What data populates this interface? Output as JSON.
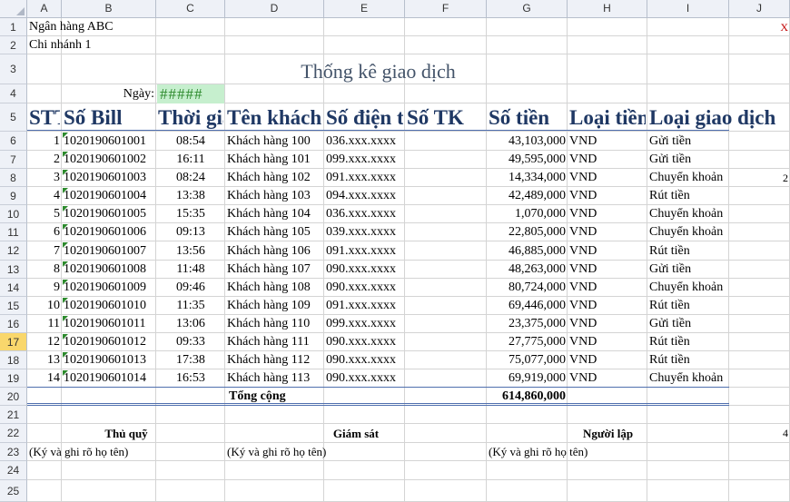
{
  "columns": [
    "A",
    "B",
    "C",
    "D",
    "E",
    "F",
    "G",
    "H",
    "I",
    "J"
  ],
  "rows": [
    "1",
    "2",
    "3",
    "4",
    "5",
    "6",
    "7",
    "8",
    "9",
    "10",
    "11",
    "12",
    "13",
    "14",
    "15",
    "16",
    "17",
    "18",
    "19",
    "20",
    "21",
    "22",
    "23",
    "24",
    "25"
  ],
  "selected_row": "17",
  "bank_name": "Ngân hàng ABC",
  "branch": "Chi nhánh 1",
  "title": "Thống kê giao dịch",
  "date_label": "Ngày:",
  "date_value": "#####",
  "headers": {
    "stt": "STT",
    "bill": "Số Bill",
    "time": "Thời gian",
    "customer": "Tên khách hàng",
    "phone": "Số điện thoại",
    "account": "Số TK",
    "amount": "Số tiền",
    "currency": "Loại tiền",
    "type": "Loại giao dịch"
  },
  "transactions": [
    {
      "stt": "1",
      "bill": "1020190601001",
      "time": "08:54",
      "customer": "Khách hàng 100",
      "phone": "036.xxx.xxxx",
      "amount": "43,103,000",
      "currency": "VND",
      "type": "Gửi tiền"
    },
    {
      "stt": "2",
      "bill": "1020190601002",
      "time": "16:11",
      "customer": "Khách hàng 101",
      "phone": "099.xxx.xxxx",
      "amount": "49,595,000",
      "currency": "VND",
      "type": "Gửi tiền"
    },
    {
      "stt": "3",
      "bill": "1020190601003",
      "time": "08:24",
      "customer": "Khách hàng 102",
      "phone": "091.xxx.xxxx",
      "amount": "14,334,000",
      "currency": "VND",
      "type": "Chuyển khoản"
    },
    {
      "stt": "4",
      "bill": "1020190601004",
      "time": "13:38",
      "customer": "Khách hàng 103",
      "phone": "094.xxx.xxxx",
      "amount": "42,489,000",
      "currency": "VND",
      "type": "Rút tiền"
    },
    {
      "stt": "5",
      "bill": "1020190601005",
      "time": "15:35",
      "customer": "Khách hàng 104",
      "phone": "036.xxx.xxxx",
      "amount": "1,070,000",
      "currency": "VND",
      "type": "Chuyển khoản"
    },
    {
      "stt": "6",
      "bill": "1020190601006",
      "time": "09:13",
      "customer": "Khách hàng 105",
      "phone": "039.xxx.xxxx",
      "amount": "22,805,000",
      "currency": "VND",
      "type": "Chuyển khoản"
    },
    {
      "stt": "7",
      "bill": "1020190601007",
      "time": "13:56",
      "customer": "Khách hàng 106",
      "phone": "091.xxx.xxxx",
      "amount": "46,885,000",
      "currency": "VND",
      "type": "Rút tiền"
    },
    {
      "stt": "8",
      "bill": "1020190601008",
      "time": "11:48",
      "customer": "Khách hàng 107",
      "phone": "090.xxx.xxxx",
      "amount": "48,263,000",
      "currency": "VND",
      "type": "Gửi tiền"
    },
    {
      "stt": "9",
      "bill": "1020190601009",
      "time": "09:46",
      "customer": "Khách hàng 108",
      "phone": "090.xxx.xxxx",
      "amount": "80,724,000",
      "currency": "VND",
      "type": "Chuyển khoản"
    },
    {
      "stt": "10",
      "bill": "1020190601010",
      "time": "11:35",
      "customer": "Khách hàng 109",
      "phone": "091.xxx.xxxx",
      "amount": "69,446,000",
      "currency": "VND",
      "type": "Rút tiền"
    },
    {
      "stt": "11",
      "bill": "1020190601011",
      "time": "13:06",
      "customer": "Khách hàng 110",
      "phone": "099.xxx.xxxx",
      "amount": "23,375,000",
      "currency": "VND",
      "type": "Gửi tiền"
    },
    {
      "stt": "12",
      "bill": "1020190601012",
      "time": "09:33",
      "customer": "Khách hàng 111",
      "phone": "090.xxx.xxxx",
      "amount": "27,775,000",
      "currency": "VND",
      "type": "Rút tiền"
    },
    {
      "stt": "13",
      "bill": "1020190601013",
      "time": "17:38",
      "customer": "Khách hàng 112",
      "phone": "090.xxx.xxxx",
      "amount": "75,077,000",
      "currency": "VND",
      "type": "Rút tiền"
    },
    {
      "stt": "14",
      "bill": "1020190601014",
      "time": "16:53",
      "customer": "Khách hàng 113",
      "phone": "090.xxx.xxxx",
      "amount": "69,919,000",
      "currency": "VND",
      "type": "Chuyển khoản"
    }
  ],
  "total_label": "Tổng cộng",
  "total_value": "614,860,000",
  "signatures": [
    {
      "role": "Thủ quỹ",
      "note": "(Ký và ghi rõ họ tên)"
    },
    {
      "role": "Giám sát",
      "note": "(Ký và ghi rõ họ tên)"
    },
    {
      "role": "Người lập",
      "note": "(Ký và ghi rõ họ tên)"
    }
  ],
  "overflow_marks": {
    "right_top": "X",
    "right_row8": "2",
    "right_row22": "4"
  },
  "colors": {
    "header_bg": "#eef1f7",
    "date_fill": "#c6efce",
    "date_text": "#2e8b2e",
    "title_color": "#1f3864",
    "selected_row": "#f9d76c"
  }
}
